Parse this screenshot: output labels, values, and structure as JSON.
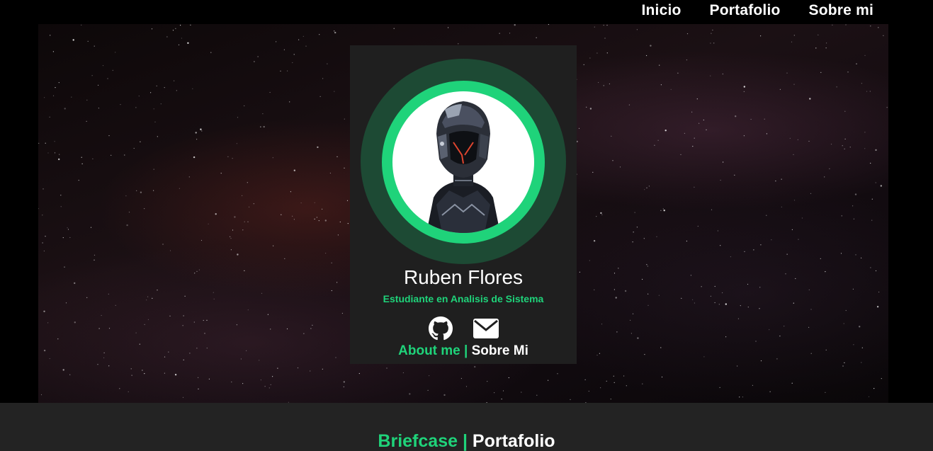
{
  "nav": {
    "items": [
      {
        "label": "Inicio"
      },
      {
        "label": "Portafolio"
      },
      {
        "label": "Sobre mi"
      }
    ]
  },
  "profile": {
    "name": "Ruben Flores",
    "role": "Estudiante en Analisis de Sistema",
    "avatar_icon": "robot-helmet-avatar",
    "social": [
      {
        "icon": "github-icon"
      },
      {
        "icon": "mail-icon"
      }
    ],
    "about_en": "About me",
    "separator": " | ",
    "about_es": "Sobre Mi"
  },
  "section": {
    "title_en": "Briefcase",
    "separator": " | ",
    "title_es": "Portafolio"
  },
  "colors": {
    "accent": "#1fd37a",
    "ring_outer": "#1d4a34",
    "card_bg": "#1f1f1f",
    "footer_bg": "#232323",
    "page_bg": "#000000"
  }
}
